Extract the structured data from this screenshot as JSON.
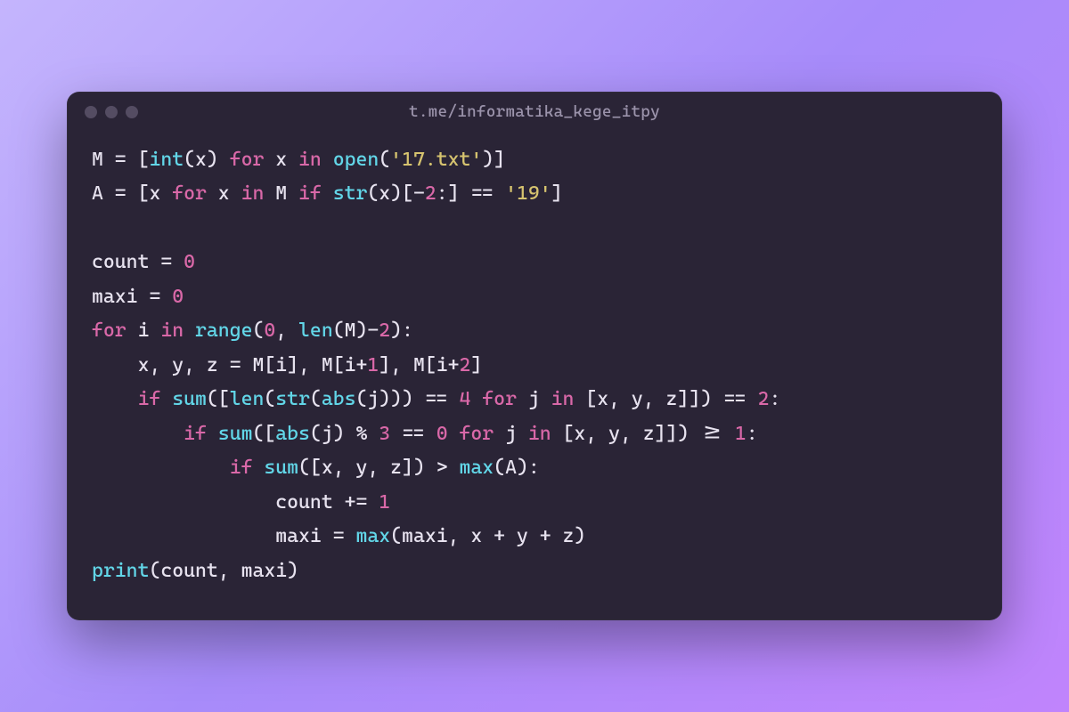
{
  "window": {
    "title": "t.me/informatika_kege_itpy"
  },
  "code": {
    "lines": [
      [
        {
          "cls": "tok-var",
          "t": "M"
        },
        {
          "cls": "tok-op",
          "t": " = "
        },
        {
          "cls": "tok-punc",
          "t": "["
        },
        {
          "cls": "tok-func",
          "t": "int"
        },
        {
          "cls": "tok-punc",
          "t": "("
        },
        {
          "cls": "tok-var",
          "t": "x"
        },
        {
          "cls": "tok-punc",
          "t": ") "
        },
        {
          "cls": "tok-kw",
          "t": "for"
        },
        {
          "cls": "tok-var",
          "t": " x "
        },
        {
          "cls": "tok-kw",
          "t": "in"
        },
        {
          "cls": "tok-var",
          "t": " "
        },
        {
          "cls": "tok-func",
          "t": "open"
        },
        {
          "cls": "tok-punc",
          "t": "("
        },
        {
          "cls": "tok-str",
          "t": "'17.txt'"
        },
        {
          "cls": "tok-punc",
          "t": ")]"
        }
      ],
      [
        {
          "cls": "tok-var",
          "t": "A"
        },
        {
          "cls": "tok-op",
          "t": " = "
        },
        {
          "cls": "tok-punc",
          "t": "["
        },
        {
          "cls": "tok-var",
          "t": "x "
        },
        {
          "cls": "tok-kw",
          "t": "for"
        },
        {
          "cls": "tok-var",
          "t": " x "
        },
        {
          "cls": "tok-kw",
          "t": "in"
        },
        {
          "cls": "tok-var",
          "t": " M "
        },
        {
          "cls": "tok-kw",
          "t": "if"
        },
        {
          "cls": "tok-var",
          "t": " "
        },
        {
          "cls": "tok-func",
          "t": "str"
        },
        {
          "cls": "tok-punc",
          "t": "("
        },
        {
          "cls": "tok-var",
          "t": "x"
        },
        {
          "cls": "tok-punc",
          "t": ")[-"
        },
        {
          "cls": "tok-num",
          "t": "2"
        },
        {
          "cls": "tok-punc",
          "t": ":] "
        },
        {
          "cls": "tok-op",
          "t": "=="
        },
        {
          "cls": "tok-var",
          "t": " "
        },
        {
          "cls": "tok-str",
          "t": "'19'"
        },
        {
          "cls": "tok-punc",
          "t": "]"
        }
      ],
      [
        {
          "cls": "tok-var",
          "t": ""
        }
      ],
      [
        {
          "cls": "tok-var",
          "t": "count "
        },
        {
          "cls": "tok-op",
          "t": "="
        },
        {
          "cls": "tok-var",
          "t": " "
        },
        {
          "cls": "tok-num",
          "t": "0"
        }
      ],
      [
        {
          "cls": "tok-var",
          "t": "maxi "
        },
        {
          "cls": "tok-op",
          "t": "="
        },
        {
          "cls": "tok-var",
          "t": " "
        },
        {
          "cls": "tok-num",
          "t": "0"
        }
      ],
      [
        {
          "cls": "tok-kw",
          "t": "for"
        },
        {
          "cls": "tok-var",
          "t": " i "
        },
        {
          "cls": "tok-kw",
          "t": "in"
        },
        {
          "cls": "tok-var",
          "t": " "
        },
        {
          "cls": "tok-func",
          "t": "range"
        },
        {
          "cls": "tok-punc",
          "t": "("
        },
        {
          "cls": "tok-num",
          "t": "0"
        },
        {
          "cls": "tok-punc",
          "t": ", "
        },
        {
          "cls": "tok-func",
          "t": "len"
        },
        {
          "cls": "tok-punc",
          "t": "("
        },
        {
          "cls": "tok-var",
          "t": "M"
        },
        {
          "cls": "tok-punc",
          "t": ")-"
        },
        {
          "cls": "tok-num",
          "t": "2"
        },
        {
          "cls": "tok-punc",
          "t": "):"
        }
      ],
      [
        {
          "cls": "tok-var",
          "t": "    x, y, z "
        },
        {
          "cls": "tok-op",
          "t": "="
        },
        {
          "cls": "tok-var",
          "t": " M"
        },
        {
          "cls": "tok-punc",
          "t": "["
        },
        {
          "cls": "tok-var",
          "t": "i"
        },
        {
          "cls": "tok-punc",
          "t": "], "
        },
        {
          "cls": "tok-var",
          "t": "M"
        },
        {
          "cls": "tok-punc",
          "t": "["
        },
        {
          "cls": "tok-var",
          "t": "i"
        },
        {
          "cls": "tok-op",
          "t": "+"
        },
        {
          "cls": "tok-num",
          "t": "1"
        },
        {
          "cls": "tok-punc",
          "t": "], "
        },
        {
          "cls": "tok-var",
          "t": "M"
        },
        {
          "cls": "tok-punc",
          "t": "["
        },
        {
          "cls": "tok-var",
          "t": "i"
        },
        {
          "cls": "tok-op",
          "t": "+"
        },
        {
          "cls": "tok-num",
          "t": "2"
        },
        {
          "cls": "tok-punc",
          "t": "]"
        }
      ],
      [
        {
          "cls": "tok-var",
          "t": "    "
        },
        {
          "cls": "tok-kw",
          "t": "if"
        },
        {
          "cls": "tok-var",
          "t": " "
        },
        {
          "cls": "tok-func",
          "t": "sum"
        },
        {
          "cls": "tok-punc",
          "t": "(["
        },
        {
          "cls": "tok-func",
          "t": "len"
        },
        {
          "cls": "tok-punc",
          "t": "("
        },
        {
          "cls": "tok-func",
          "t": "str"
        },
        {
          "cls": "tok-punc",
          "t": "("
        },
        {
          "cls": "tok-func",
          "t": "abs"
        },
        {
          "cls": "tok-punc",
          "t": "("
        },
        {
          "cls": "tok-var",
          "t": "j"
        },
        {
          "cls": "tok-punc",
          "t": "))) "
        },
        {
          "cls": "tok-op",
          "t": "=="
        },
        {
          "cls": "tok-var",
          "t": " "
        },
        {
          "cls": "tok-num",
          "t": "4"
        },
        {
          "cls": "tok-var",
          "t": " "
        },
        {
          "cls": "tok-kw",
          "t": "for"
        },
        {
          "cls": "tok-var",
          "t": " j "
        },
        {
          "cls": "tok-kw",
          "t": "in"
        },
        {
          "cls": "tok-var",
          "t": " "
        },
        {
          "cls": "tok-punc",
          "t": "["
        },
        {
          "cls": "tok-var",
          "t": "x, y, z"
        },
        {
          "cls": "tok-punc",
          "t": "]]) "
        },
        {
          "cls": "tok-op",
          "t": "=="
        },
        {
          "cls": "tok-var",
          "t": " "
        },
        {
          "cls": "tok-num",
          "t": "2"
        },
        {
          "cls": "tok-punc",
          "t": ":"
        }
      ],
      [
        {
          "cls": "tok-var",
          "t": "        "
        },
        {
          "cls": "tok-kw",
          "t": "if"
        },
        {
          "cls": "tok-var",
          "t": " "
        },
        {
          "cls": "tok-func",
          "t": "sum"
        },
        {
          "cls": "tok-punc",
          "t": "(["
        },
        {
          "cls": "tok-func",
          "t": "abs"
        },
        {
          "cls": "tok-punc",
          "t": "("
        },
        {
          "cls": "tok-var",
          "t": "j"
        },
        {
          "cls": "tok-punc",
          "t": ") "
        },
        {
          "cls": "tok-op",
          "t": "%"
        },
        {
          "cls": "tok-var",
          "t": " "
        },
        {
          "cls": "tok-num",
          "t": "3"
        },
        {
          "cls": "tok-var",
          "t": " "
        },
        {
          "cls": "tok-op",
          "t": "=="
        },
        {
          "cls": "tok-var",
          "t": " "
        },
        {
          "cls": "tok-num",
          "t": "0"
        },
        {
          "cls": "tok-var",
          "t": " "
        },
        {
          "cls": "tok-kw",
          "t": "for"
        },
        {
          "cls": "tok-var",
          "t": " j "
        },
        {
          "cls": "tok-kw",
          "t": "in"
        },
        {
          "cls": "tok-var",
          "t": " "
        },
        {
          "cls": "tok-punc",
          "t": "["
        },
        {
          "cls": "tok-var",
          "t": "x, y, z"
        },
        {
          "cls": "tok-punc",
          "t": "]]) "
        },
        {
          "cls": "tok-op",
          "t": ">="
        },
        {
          "cls": "tok-var",
          "t": " "
        },
        {
          "cls": "tok-num",
          "t": "1"
        },
        {
          "cls": "tok-punc",
          "t": ":"
        }
      ],
      [
        {
          "cls": "tok-var",
          "t": "            "
        },
        {
          "cls": "tok-kw",
          "t": "if"
        },
        {
          "cls": "tok-var",
          "t": " "
        },
        {
          "cls": "tok-func",
          "t": "sum"
        },
        {
          "cls": "tok-punc",
          "t": "(["
        },
        {
          "cls": "tok-var",
          "t": "x, y, z"
        },
        {
          "cls": "tok-punc",
          "t": "]) "
        },
        {
          "cls": "tok-op",
          "t": ">"
        },
        {
          "cls": "tok-var",
          "t": " "
        },
        {
          "cls": "tok-func",
          "t": "max"
        },
        {
          "cls": "tok-punc",
          "t": "("
        },
        {
          "cls": "tok-var",
          "t": "A"
        },
        {
          "cls": "tok-punc",
          "t": "):"
        }
      ],
      [
        {
          "cls": "tok-var",
          "t": "                count "
        },
        {
          "cls": "tok-op",
          "t": "+="
        },
        {
          "cls": "tok-var",
          "t": " "
        },
        {
          "cls": "tok-num",
          "t": "1"
        }
      ],
      [
        {
          "cls": "tok-var",
          "t": "                maxi "
        },
        {
          "cls": "tok-op",
          "t": "="
        },
        {
          "cls": "tok-var",
          "t": " "
        },
        {
          "cls": "tok-func",
          "t": "max"
        },
        {
          "cls": "tok-punc",
          "t": "("
        },
        {
          "cls": "tok-var",
          "t": "maxi, x "
        },
        {
          "cls": "tok-op",
          "t": "+"
        },
        {
          "cls": "tok-var",
          "t": " y "
        },
        {
          "cls": "tok-op",
          "t": "+"
        },
        {
          "cls": "tok-var",
          "t": " z"
        },
        {
          "cls": "tok-punc",
          "t": ")"
        }
      ],
      [
        {
          "cls": "tok-func",
          "t": "print"
        },
        {
          "cls": "tok-punc",
          "t": "("
        },
        {
          "cls": "tok-var",
          "t": "count, maxi"
        },
        {
          "cls": "tok-punc",
          "t": ")"
        }
      ]
    ]
  }
}
